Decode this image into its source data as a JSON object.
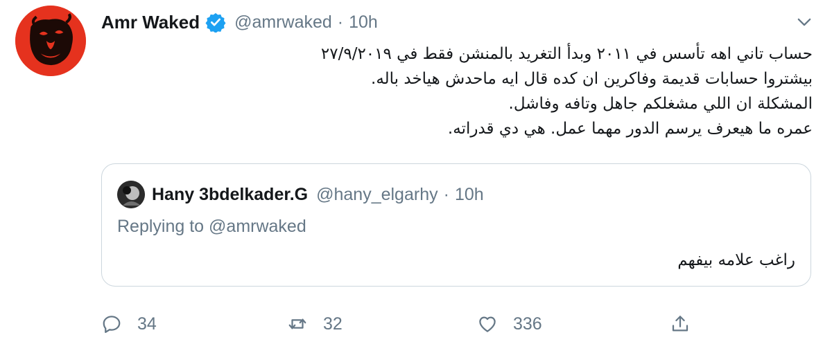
{
  "tweet": {
    "author_name": "Amr Waked",
    "handle": "@amrwaked",
    "separator": "·",
    "time": "10h",
    "lines": [
      "حساب تاني اهه تأسس في ٢٠١١ وبدأ التغريد بالمنشن فقط في ٢٧/٩/٢٠١٩",
      "بيشتروا حسابات قديمة وفاكرين ان كده قال ايه ماحدش هياخد باله.",
      "المشكلة ان اللي مشغلكم جاهل وتافه وفاشل.",
      "عمره ما هيعرف يرسم الدور مهما عمل. هي دي قدراته."
    ]
  },
  "quoted": {
    "author_name": "Hany 3bdelkader.G",
    "handle": "@hany_elgarhy",
    "separator": "·",
    "time": "10h",
    "replying_prefix": "Replying to",
    "replying_to": "@amrwaked",
    "text": "راغب علامه بيفهم"
  },
  "actions": {
    "reply_count": "34",
    "retweet_count": "32",
    "like_count": "336"
  },
  "colors": {
    "verified": "#1da1f2",
    "secondary_text": "#657786",
    "border": "#ccd6dd",
    "avatar_bg": "#e5321e"
  },
  "icons": [
    "verified-badge-icon",
    "chevron-down-icon",
    "reply-icon",
    "retweet-icon",
    "like-icon",
    "share-icon"
  ]
}
